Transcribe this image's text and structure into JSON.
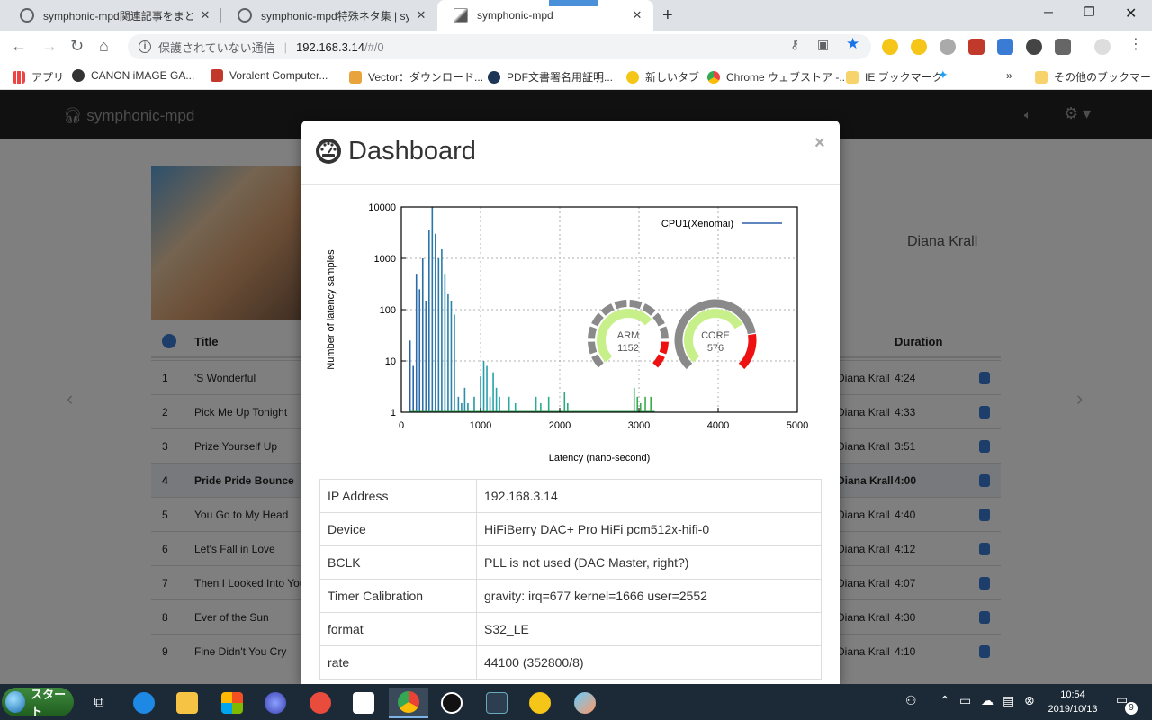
{
  "browser": {
    "tabs": [
      {
        "title": "symphonic-mpd関連記事をまとめ",
        "active": false
      },
      {
        "title": "symphonic-mpd特殊ネタ集 | symp",
        "active": false
      },
      {
        "title": "symphonic-mpd",
        "active": true
      }
    ],
    "omnibox": {
      "security": "保護されていない通信",
      "host": "192.168.3.14",
      "path": "/#/0"
    },
    "bookmarks": [
      "アプリ",
      "CANON iMAGE GA...",
      "Voralent Computer...",
      "Vector：ダウンロード...",
      "PDF文書署名用証明...",
      "新しいタブ",
      "Chrome ウェブストア -...",
      "IE ブックマーク"
    ],
    "bookmarks_more": "»",
    "bookmarks_other": "その他のブックマーク"
  },
  "app": {
    "brand": "symphonic-mpd",
    "artist": "Diana Krall",
    "table_headers": {
      "title": "Title",
      "duration": "Duration"
    },
    "tracks": [
      {
        "num": "1",
        "title": "'S Wonderful",
        "artist": "Diana Krall",
        "duration": "4:24"
      },
      {
        "num": "2",
        "title": "Pick Me Up Tonight",
        "artist": "Diana Krall",
        "duration": "4:33"
      },
      {
        "num": "3",
        "title": "Prize Yourself Up",
        "artist": "Diana Krall",
        "duration": "3:51"
      },
      {
        "num": "4",
        "title": "Pride Pride Bounce",
        "artist": "Diana Krall",
        "duration": "4:00"
      },
      {
        "num": "5",
        "title": "You Go to My Head",
        "artist": "Diana Krall",
        "duration": "4:40"
      },
      {
        "num": "6",
        "title": "Let's Fall in Love",
        "artist": "Diana Krall",
        "duration": "4:12"
      },
      {
        "num": "7",
        "title": "Then I Looked Into Your Eyes",
        "artist": "Diana Krall",
        "duration": "4:07"
      },
      {
        "num": "8",
        "title": "Ever of the Sun",
        "artist": "Diana Krall",
        "duration": "4:30"
      },
      {
        "num": "9",
        "title": "Fine Didn't You Cry",
        "artist": "Diana Krall",
        "duration": "4:10"
      }
    ]
  },
  "modal": {
    "title": "Dashboard",
    "close": "×",
    "info": [
      {
        "key": "IP Address",
        "value": "192.168.3.14"
      },
      {
        "key": "Device",
        "value": "HiFiBerry DAC+ Pro HiFi pcm512x-hifi-0"
      },
      {
        "key": "BCLK",
        "value": "PLL is not used (DAC Master, right?)"
      },
      {
        "key": "Timer Calibration",
        "value": "gravity: irq=677 kernel=1666 user=2552"
      },
      {
        "key": "format",
        "value": "S32_LE"
      },
      {
        "key": "rate",
        "value": "44100 (352800/8)"
      }
    ],
    "gauges": [
      {
        "label": "ARM",
        "value": "1152",
        "fraction": 0.68
      },
      {
        "label": "CORE",
        "value": "576",
        "fraction": 0.72
      }
    ]
  },
  "chart_data": {
    "type": "bar",
    "xlabel": "Latency (nano-second)",
    "ylabel": "Number of latency samples",
    "xlim": [
      0,
      5000
    ],
    "ylim": [
      1,
      10000
    ],
    "y_scale": "log",
    "x_ticks": [
      "0",
      "1000",
      "2000",
      "3000",
      "4000",
      "5000"
    ],
    "y_ticks": [
      "1",
      "10",
      "100",
      "1000",
      "10000"
    ],
    "grid": true,
    "legend_position": "top-right",
    "series": [
      {
        "name": "CPU1(Xenomai)",
        "color": "#2b5fa8",
        "x": [
          110,
          150,
          190,
          230,
          270,
          310,
          350,
          390,
          430,
          470,
          510,
          550,
          590,
          630,
          670,
          720,
          760,
          800,
          840,
          920,
          1000,
          1040,
          1080,
          1120,
          1160,
          1200,
          1240,
          1360,
          1440,
          1700,
          1760,
          1860,
          2060,
          2100,
          2940,
          2980,
          3020,
          3080,
          3150
        ],
        "y": [
          25,
          8,
          500,
          250,
          1000,
          150,
          3500,
          10000,
          3000,
          1000,
          1500,
          500,
          200,
          150,
          80,
          2,
          1.5,
          3,
          1.5,
          2,
          5,
          10,
          8,
          2,
          6,
          3,
          2,
          2,
          1.5,
          2,
          1.5,
          2,
          2.5,
          1.5,
          3,
          2,
          1.5,
          2,
          2
        ]
      }
    ]
  },
  "taskbar": {
    "start_label": "スタート",
    "time": "10:54",
    "date": "2019/10/13",
    "notification_count": "9"
  },
  "colors": {
    "gauge_ok": "#c8f08a",
    "gauge_warn": "#ee1111",
    "gauge_bg": "#8a8a8a",
    "navbar": "#222222"
  }
}
